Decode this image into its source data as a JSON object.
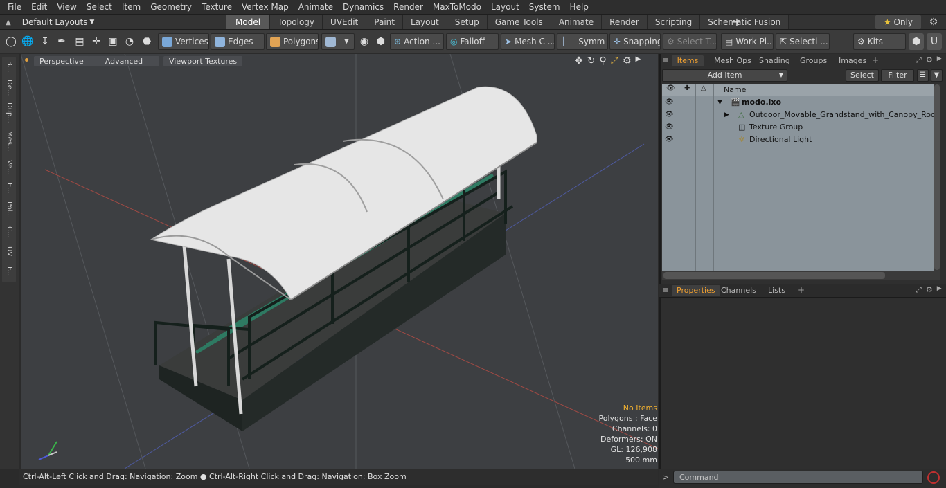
{
  "menu": [
    "File",
    "Edit",
    "View",
    "Select",
    "Item",
    "Geometry",
    "Texture",
    "Vertex Map",
    "Animate",
    "Dynamics",
    "Render",
    "MaxToModo",
    "Layout",
    "System",
    "Help"
  ],
  "layout_selector": "Default Layouts",
  "tabs": [
    "Model",
    "Topology",
    "UVEdit",
    "Paint",
    "Layout",
    "Setup",
    "Game Tools",
    "Animate",
    "Render",
    "Scripting",
    "Schematic Fusion"
  ],
  "active_tab": "Model",
  "only_label": "Only",
  "toolbar": {
    "vertices": "Vertices",
    "edges": "Edges",
    "polygons": "Polygons",
    "action": "Action ...",
    "falloff": "Falloff",
    "mesh": "Mesh C ...",
    "symm": "Symm ...",
    "snapping": "Snapping",
    "select_t": "Select T...",
    "work_pl": "Work Pl...",
    "selecti": "Selecti ...",
    "kits": "Kits"
  },
  "left_tabs": [
    "B...",
    "De...",
    "Dup...",
    "Mes...",
    "Ve...",
    "E...",
    "Pol...",
    "C...",
    "UV",
    "F..."
  ],
  "viewport": {
    "perspective": "Perspective",
    "advanced": "Advanced",
    "viewport_textures": "Viewport Textures",
    "stats": {
      "no_items": "No Items",
      "polygons": "Polygons : Face",
      "channels": "Channels: 0",
      "deformers": "Deformers: ON",
      "gl": "GL: 126,908",
      "unit": "500 mm"
    }
  },
  "status": {
    "hint1": "Ctrl-Alt-Left Click and Drag: Navigation: Zoom",
    "hint2": "Ctrl-Alt-Right Click and Drag: Navigation: Box Zoom"
  },
  "items_panel": {
    "tabs": [
      "Items",
      "Mesh Ops",
      "Shading",
      "Groups",
      "Images"
    ],
    "active": "Items",
    "add_item": "Add Item",
    "select": "Select",
    "filter": "Filter",
    "col_name": "Name",
    "tree": [
      {
        "label": "modo.lxo",
        "level": 0
      },
      {
        "label": "Outdoor_Movable_Grandstand_with_Canopy_Roof",
        "level": 1
      },
      {
        "label": "Texture Group",
        "level": 1
      },
      {
        "label": "Directional Light",
        "level": 1
      }
    ]
  },
  "props_panel": {
    "tabs": [
      "Properties",
      "Channels",
      "Lists"
    ],
    "active": "Properties"
  },
  "command_placeholder": "Command",
  "colors": {
    "accent": "#f0a030",
    "canopy": "#e6e6e6",
    "bench": "#2e7a62",
    "frame": "#1a2420"
  }
}
